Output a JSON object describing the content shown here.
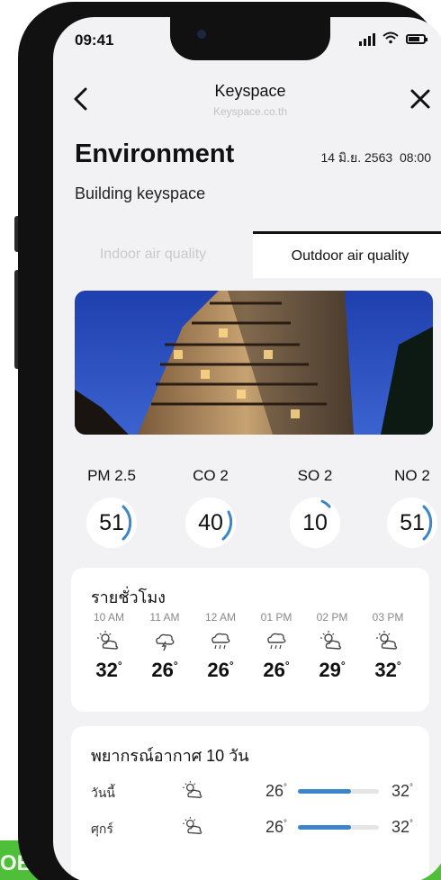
{
  "status": {
    "time": "09:41"
  },
  "nav": {
    "title": "Keyspace",
    "subtitle": "Keyspace.co.th"
  },
  "page": {
    "title": "Environment",
    "date": "14 มิ.ย. 2563",
    "time": "08:00",
    "building": "Building keyspace"
  },
  "tabs": {
    "indoor": "Indoor air quality",
    "outdoor": "Outdoor air quality",
    "active": "outdoor"
  },
  "metrics": [
    {
      "label": "PM 2.5",
      "value": "51",
      "level": 0.35
    },
    {
      "label": "CO 2",
      "value": "40",
      "level": 0.28
    },
    {
      "label": "SO 2",
      "value": "10",
      "level": 0.08
    },
    {
      "label": "NO 2",
      "value": "51",
      "level": 0.35
    }
  ],
  "hourly": {
    "title": "รายชั่วโมง",
    "items": [
      {
        "time": "10 AM",
        "icon": "sun-cloud-icon",
        "temp": "32"
      },
      {
        "time": "11 AM",
        "icon": "cloud-lightning-icon",
        "temp": "26"
      },
      {
        "time": "12 AM",
        "icon": "cloud-rain-icon",
        "temp": "26"
      },
      {
        "time": "01 PM",
        "icon": "cloud-rain-icon",
        "temp": "26"
      },
      {
        "time": "02 PM",
        "icon": "sun-cloud-icon",
        "temp": "29"
      },
      {
        "time": "03 PM",
        "icon": "sun-cloud-icon",
        "temp": "32"
      }
    ]
  },
  "forecast": {
    "title": "พยากรณ์อากาศ 10 วัน",
    "items": [
      {
        "day": "วันนี้",
        "icon": "sun-cloud-icon",
        "low": "26",
        "high": "32",
        "range_start": 0.0,
        "range_end": 0.65
      },
      {
        "day": "ศุกร์",
        "icon": "sun-cloud-icon",
        "low": "26",
        "high": "32",
        "range_start": 0.0,
        "range_end": 0.65
      }
    ]
  },
  "banner": {
    "text": "OE G"
  },
  "colors": {
    "accent": "#3a86c8",
    "banner": "#4fbf3a"
  }
}
